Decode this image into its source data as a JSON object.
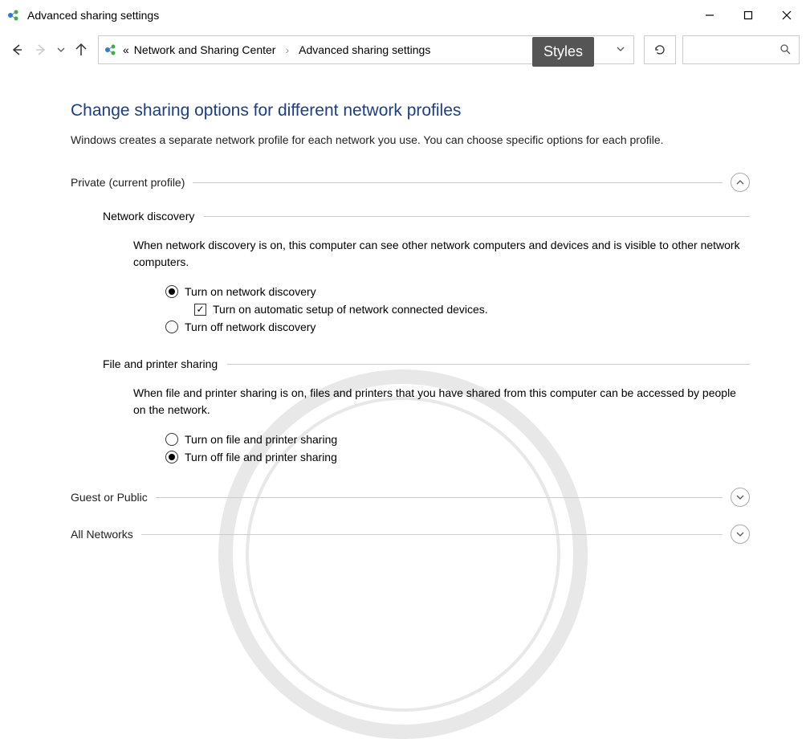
{
  "window": {
    "title": "Advanced sharing settings",
    "minimize": "—",
    "maximize": "☐",
    "close": "✕"
  },
  "breadcrumb": {
    "chevron_left": "«",
    "part1": "Network and Sharing Center",
    "sep": "›",
    "part2": "Advanced sharing settings"
  },
  "styles_badge": "Styles",
  "page": {
    "heading": "Change sharing options for different network profiles",
    "description": "Windows creates a separate network profile for each network you use. You can choose specific options for each profile."
  },
  "sections": {
    "private": {
      "title": "Private (current profile)",
      "expanded": true,
      "network_discovery": {
        "title": "Network discovery",
        "description": "When network discovery is on, this computer can see other network computers and devices and is visible to other network computers.",
        "options": {
          "on": "Turn on network discovery",
          "auto_setup": "Turn on automatic setup of network connected devices.",
          "off": "Turn off network discovery"
        }
      },
      "file_printer": {
        "title": "File and printer sharing",
        "description": "When file and printer sharing is on, files and printers that you have shared from this computer can be accessed by people on the network.",
        "options": {
          "on": "Turn on file and printer sharing",
          "off": "Turn off file and printer sharing"
        }
      }
    },
    "guest": {
      "title": "Guest or Public"
    },
    "all": {
      "title": "All Networks"
    }
  }
}
